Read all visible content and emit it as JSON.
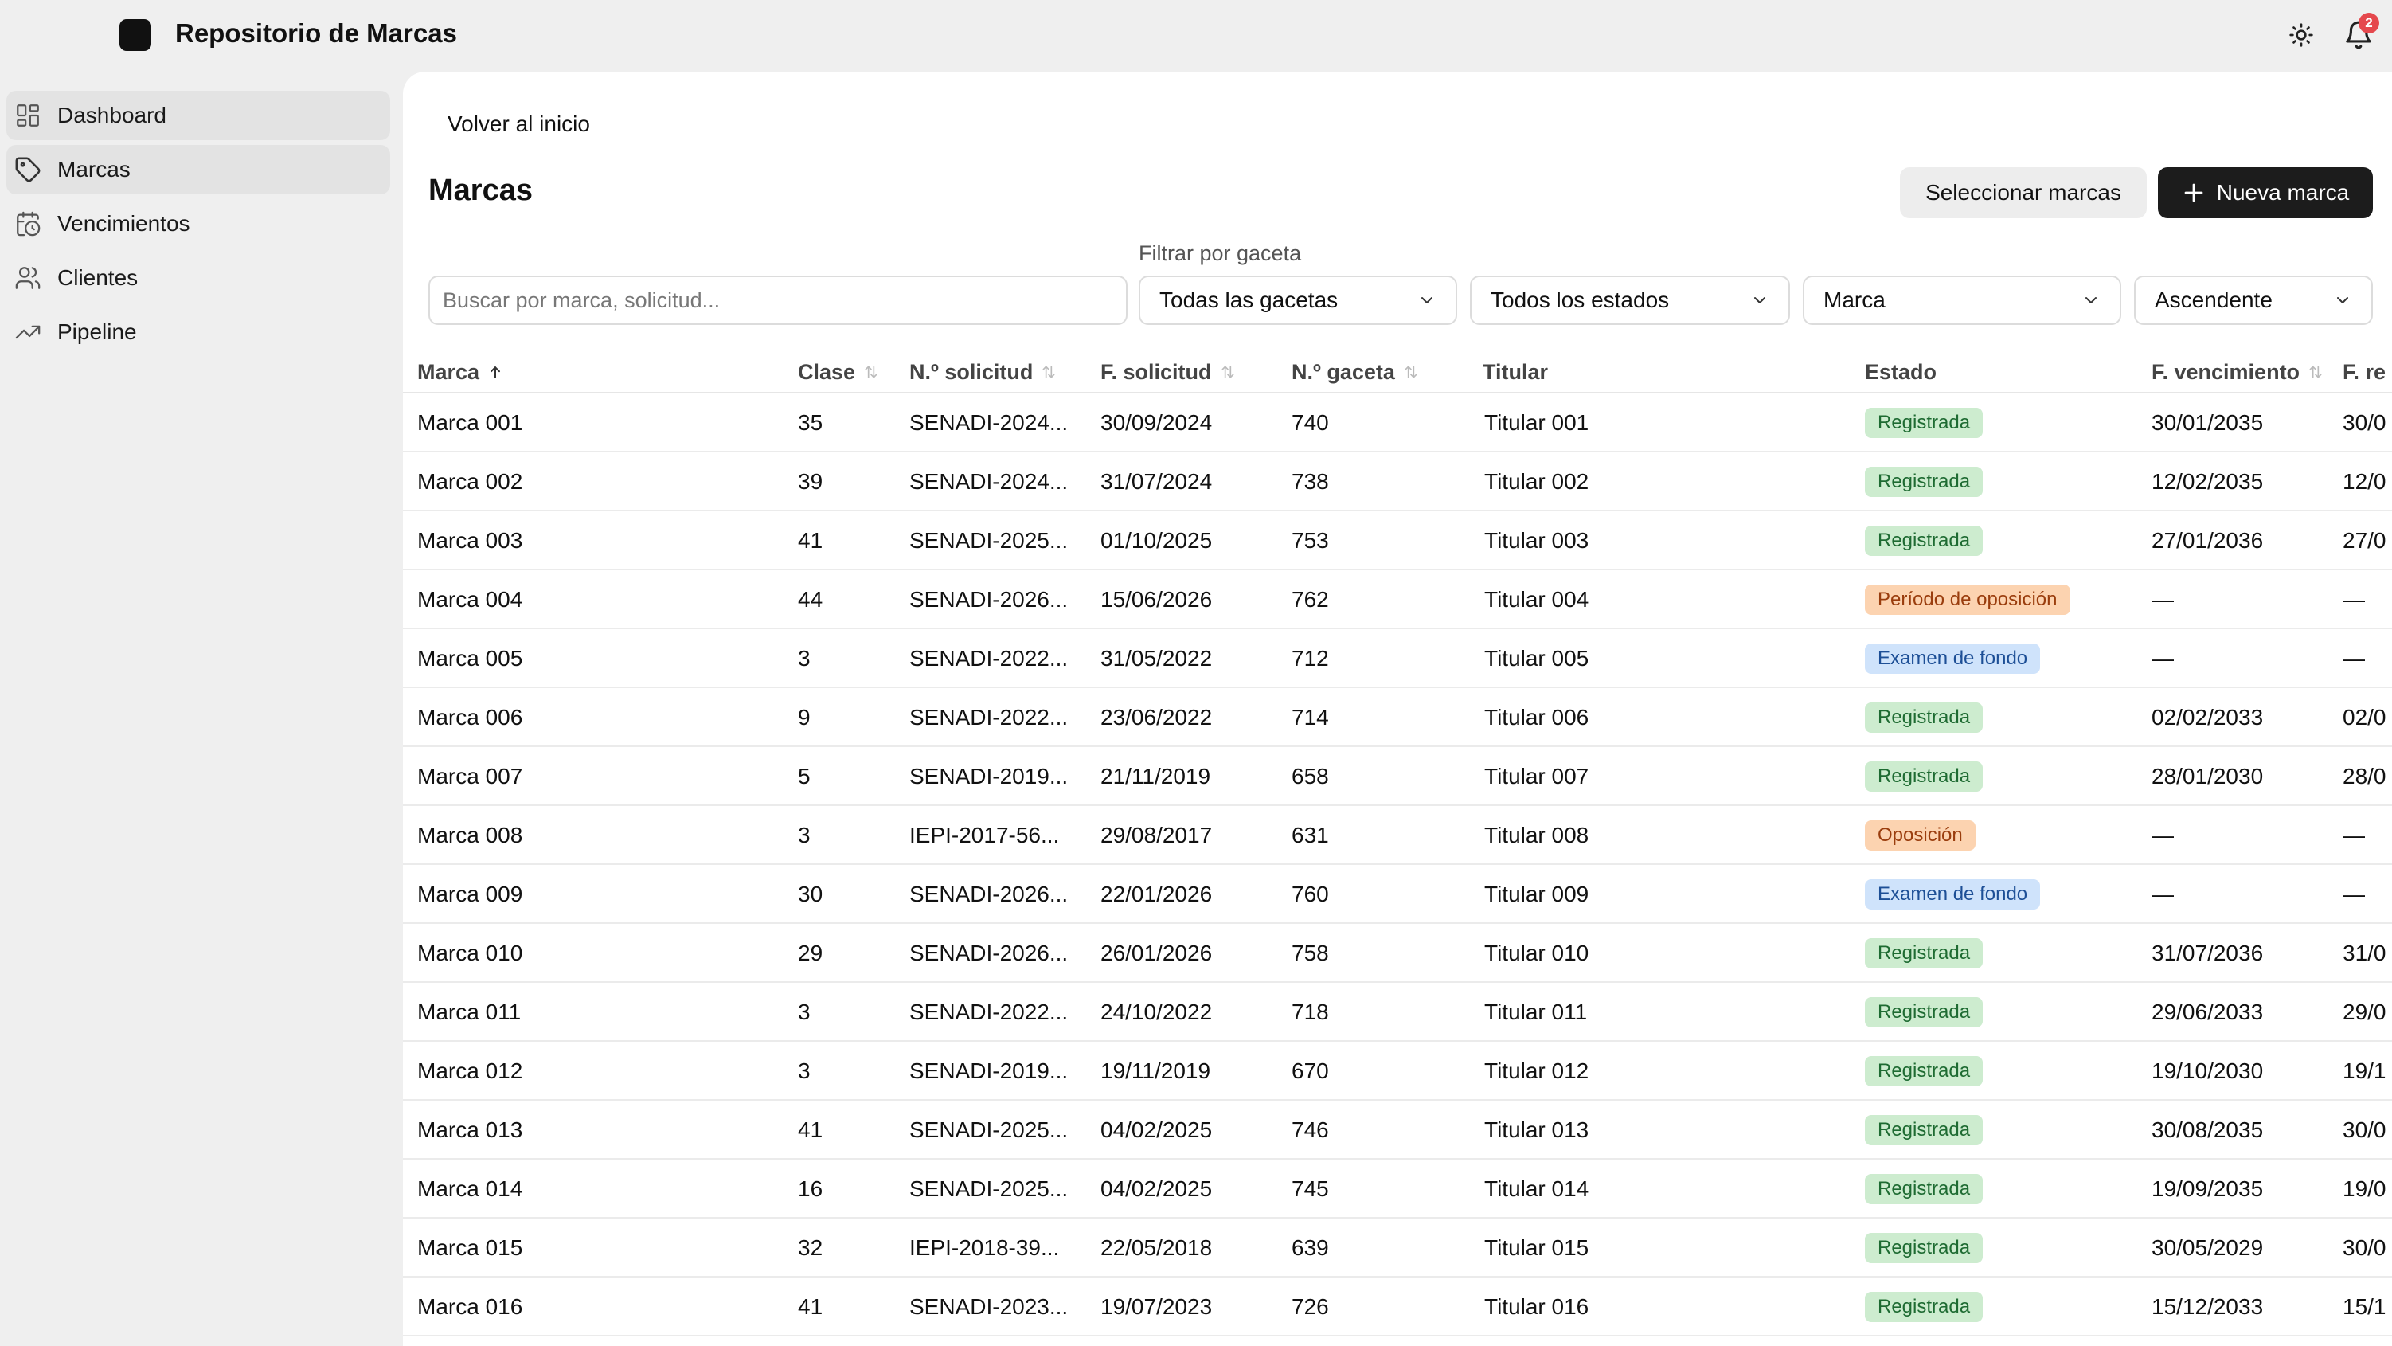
{
  "app": {
    "title": "Repositorio de Marcas",
    "notifications_count": "2"
  },
  "sidebar": {
    "items": [
      {
        "label": "Dashboard",
        "icon": "dashboard-icon"
      },
      {
        "label": "Marcas",
        "icon": "tag-icon",
        "active": true
      },
      {
        "label": "Vencimientos",
        "icon": "calendar-clock-icon"
      },
      {
        "label": "Clientes",
        "icon": "users-icon"
      },
      {
        "label": "Pipeline",
        "icon": "trending-up-icon"
      }
    ]
  },
  "main": {
    "back_link": "Volver al inicio",
    "title": "Marcas",
    "select_button": "Seleccionar marcas",
    "new_button": "Nueva marca",
    "filters": {
      "gaceta_label": "Filtrar por gaceta",
      "search_placeholder": "Buscar por marca, solicitud...",
      "gaceta": "Todas las gacetas",
      "estado": "Todos los estados",
      "sort_field": "Marca",
      "sort_order": "Ascendente"
    },
    "columns": [
      "Marca",
      "Clase",
      "N.º solicitud",
      "F. solicitud",
      "N.º gaceta",
      "Titular",
      "Estado",
      "F. vencimiento",
      "F. re"
    ],
    "rows": [
      {
        "marca": "Marca 001",
        "clase": "35",
        "solicitud": "SENADI-2024...",
        "f_solicitud": "30/09/2024",
        "gaceta": "740",
        "titular": "Titular 001",
        "estado": "Registrada",
        "estado_tone": "green",
        "f_vencimiento": "30/01/2035",
        "f_re": "30/0"
      },
      {
        "marca": "Marca 002",
        "clase": "39",
        "solicitud": "SENADI-2024...",
        "f_solicitud": "31/07/2024",
        "gaceta": "738",
        "titular": "Titular 002",
        "estado": "Registrada",
        "estado_tone": "green",
        "f_vencimiento": "12/02/2035",
        "f_re": "12/0"
      },
      {
        "marca": "Marca 003",
        "clase": "41",
        "solicitud": "SENADI-2025...",
        "f_solicitud": "01/10/2025",
        "gaceta": "753",
        "titular": "Titular 003",
        "estado": "Registrada",
        "estado_tone": "green",
        "f_vencimiento": "27/01/2036",
        "f_re": "27/0"
      },
      {
        "marca": "Marca 004",
        "clase": "44",
        "solicitud": "SENADI-2026...",
        "f_solicitud": "15/06/2026",
        "gaceta": "762",
        "titular": "Titular 004",
        "estado": "Período de oposición",
        "estado_tone": "orange",
        "f_vencimiento": "—",
        "f_re": "—"
      },
      {
        "marca": "Marca 005",
        "clase": "3",
        "solicitud": "SENADI-2022...",
        "f_solicitud": "31/05/2022",
        "gaceta": "712",
        "titular": "Titular 005",
        "estado": "Examen de fondo",
        "estado_tone": "blue",
        "f_vencimiento": "—",
        "f_re": "—"
      },
      {
        "marca": "Marca 006",
        "clase": "9",
        "solicitud": "SENADI-2022...",
        "f_solicitud": "23/06/2022",
        "gaceta": "714",
        "titular": "Titular 006",
        "estado": "Registrada",
        "estado_tone": "green",
        "f_vencimiento": "02/02/2033",
        "f_re": "02/0"
      },
      {
        "marca": "Marca 007",
        "clase": "5",
        "solicitud": "SENADI-2019...",
        "f_solicitud": "21/11/2019",
        "gaceta": "658",
        "titular": "Titular 007",
        "estado": "Registrada",
        "estado_tone": "green",
        "f_vencimiento": "28/01/2030",
        "f_re": "28/0"
      },
      {
        "marca": "Marca 008",
        "clase": "3",
        "solicitud": "IEPI-2017-56...",
        "f_solicitud": "29/08/2017",
        "gaceta": "631",
        "titular": "Titular 008",
        "estado": "Oposición",
        "estado_tone": "orange",
        "f_vencimiento": "—",
        "f_re": "—"
      },
      {
        "marca": "Marca 009",
        "clase": "30",
        "solicitud": "SENADI-2026...",
        "f_solicitud": "22/01/2026",
        "gaceta": "760",
        "titular": "Titular 009",
        "estado": "Examen de fondo",
        "estado_tone": "blue",
        "f_vencimiento": "—",
        "f_re": "—"
      },
      {
        "marca": "Marca 010",
        "clase": "29",
        "solicitud": "SENADI-2026...",
        "f_solicitud": "26/01/2026",
        "gaceta": "758",
        "titular": "Titular 010",
        "estado": "Registrada",
        "estado_tone": "green",
        "f_vencimiento": "31/07/2036",
        "f_re": "31/0"
      },
      {
        "marca": "Marca 011",
        "clase": "3",
        "solicitud": "SENADI-2022...",
        "f_solicitud": "24/10/2022",
        "gaceta": "718",
        "titular": "Titular 011",
        "estado": "Registrada",
        "estado_tone": "green",
        "f_vencimiento": "29/06/2033",
        "f_re": "29/0"
      },
      {
        "marca": "Marca 012",
        "clase": "3",
        "solicitud": "SENADI-2019...",
        "f_solicitud": "19/11/2019",
        "gaceta": "670",
        "titular": "Titular 012",
        "estado": "Registrada",
        "estado_tone": "green",
        "f_vencimiento": "19/10/2030",
        "f_re": "19/1"
      },
      {
        "marca": "Marca 013",
        "clase": "41",
        "solicitud": "SENADI-2025...",
        "f_solicitud": "04/02/2025",
        "gaceta": "746",
        "titular": "Titular 013",
        "estado": "Registrada",
        "estado_tone": "green",
        "f_vencimiento": "30/08/2035",
        "f_re": "30/0"
      },
      {
        "marca": "Marca 014",
        "clase": "16",
        "solicitud": "SENADI-2025...",
        "f_solicitud": "04/02/2025",
        "gaceta": "745",
        "titular": "Titular 014",
        "estado": "Registrada",
        "estado_tone": "green",
        "f_vencimiento": "19/09/2035",
        "f_re": "19/0"
      },
      {
        "marca": "Marca 015",
        "clase": "32",
        "solicitud": "IEPI-2018-39...",
        "f_solicitud": "22/05/2018",
        "gaceta": "639",
        "titular": "Titular 015",
        "estado": "Registrada",
        "estado_tone": "green",
        "f_vencimiento": "30/05/2029",
        "f_re": "30/0"
      },
      {
        "marca": "Marca 016",
        "clase": "41",
        "solicitud": "SENADI-2023...",
        "f_solicitud": "19/07/2023",
        "gaceta": "726",
        "titular": "Titular 016",
        "estado": "Registrada",
        "estado_tone": "green",
        "f_vencimiento": "15/12/2033",
        "f_re": "15/1"
      }
    ]
  },
  "colors": {
    "accent": "#1c1c1c",
    "badge_green": "#cdeccf",
    "badge_orange": "#fcd3b0",
    "badge_blue": "#cfe3fb"
  }
}
